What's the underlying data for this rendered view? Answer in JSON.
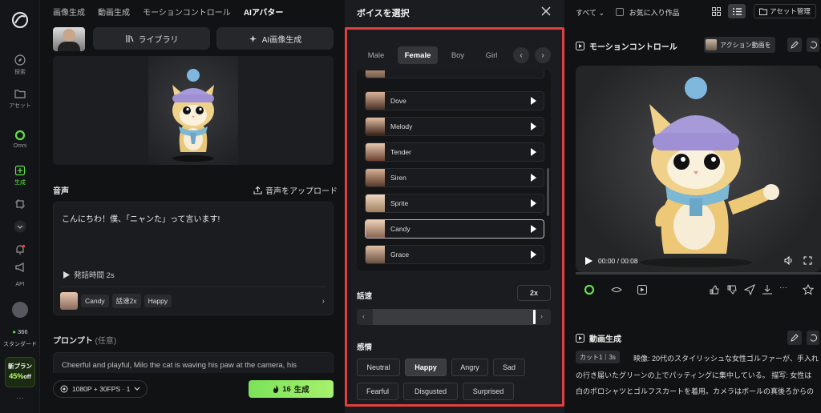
{
  "rail": {
    "items": [
      {
        "label": "探索",
        "icon": "compass-icon"
      },
      {
        "label": "アセット",
        "icon": "folder-icon"
      },
      {
        "label": "Omni",
        "icon": "omni-icon"
      },
      {
        "label": "生成",
        "icon": "generate-icon"
      },
      {
        "label": "API"
      }
    ],
    "coins": "366",
    "plan_label": "スタンダード",
    "promo_title": "新プラン",
    "promo_discount": "45%",
    "promo_suffix": "off"
  },
  "topnav": {
    "tabs": [
      "画像生成",
      "動画生成",
      "モーションコントロール",
      "AIアバター"
    ],
    "active_index": 3
  },
  "left": {
    "library_label": "ライブラリ",
    "ai_image_label": "AI画像生成",
    "voice_title": "音声",
    "upload_label": "音声をアップロード",
    "voice_text": "こんにちわ！僕、「ニャンた」って言います!",
    "speak_duration": "発話時間 2s",
    "voice_chips": [
      "Candy",
      "話速2x",
      "Happy"
    ],
    "prompt_title": "プロンプト",
    "prompt_optional": "(任意)",
    "prompt_text": "Cheerful and playful, Milo the cat is waving his paw at the camera, his",
    "settings_label": "1080P + 30FPS · 1",
    "generate_cost": "16",
    "generate_label": "生成"
  },
  "modal": {
    "title": "ボイスを選択",
    "tabs": [
      "Male",
      "Female",
      "Boy",
      "Girl"
    ],
    "active_tab_index": 1,
    "voices": [
      {
        "name": "Dove",
        "selected": false
      },
      {
        "name": "Melody",
        "selected": false
      },
      {
        "name": "Tender",
        "selected": false
      },
      {
        "name": "Siren",
        "selected": false
      },
      {
        "name": "Sprite",
        "selected": false
      },
      {
        "name": "Candy",
        "selected": true
      },
      {
        "name": "Grace",
        "selected": false
      }
    ],
    "speed_label": "話速",
    "speed_value": "2x",
    "speed_level": 1.0,
    "emotion_label": "感情",
    "emotions": [
      "Neutral",
      "Happy",
      "Angry",
      "Sad",
      "Fearful",
      "Disgusted",
      "Surprised"
    ],
    "active_emotion": "Happy"
  },
  "right": {
    "filter_all": "すべて",
    "favorites_label": "お気に入り作品",
    "asset_manage": "アセット管理",
    "motion_title": "モーションコントロール",
    "action_video_label": "アクション動画を",
    "time_display": "00:00 / 00:08",
    "video_gen_title": "動画生成",
    "cut_label": "カット1｜3s",
    "desc_line1": "映像:  20代のスタイリッシュな女性ゴルファーが、手入れ",
    "desc_line2": "の行き届いたグリーンの上でパッティングに集中している。 描写:  女性は",
    "desc_line3": "白のポロシャツとゴルフスカートを着用。カメラはボールの真後ろからの"
  },
  "colors": {
    "accent": "#63e04a",
    "highlight": "#e04040"
  }
}
